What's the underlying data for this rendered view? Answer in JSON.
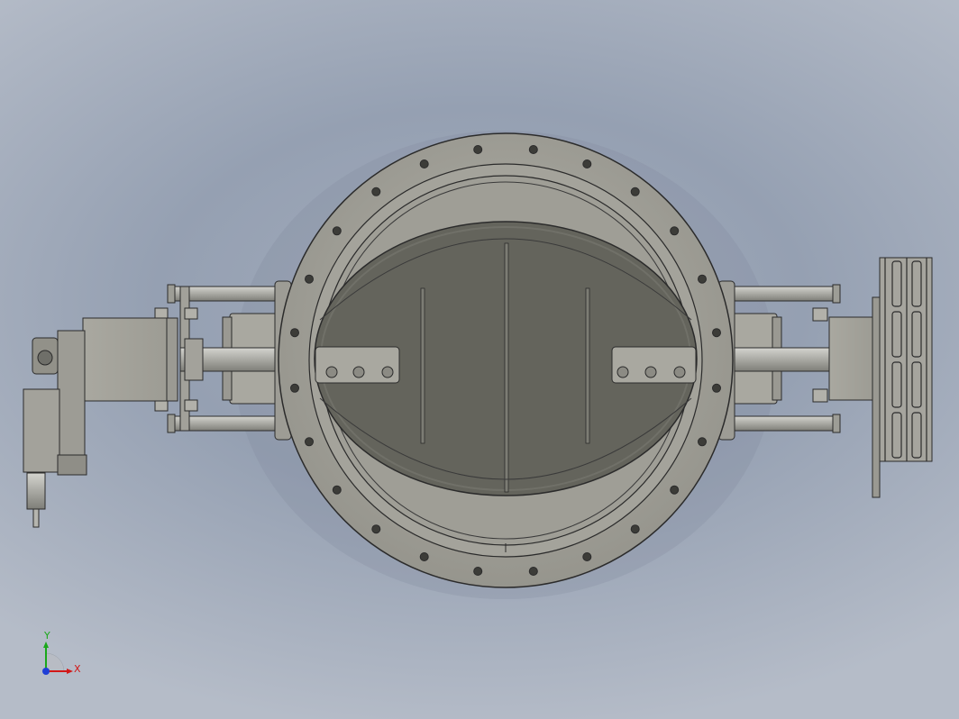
{
  "viewport": {
    "background_colors": [
      "#a3acbc",
      "#95a0b2",
      "#b5bcc8"
    ],
    "model": "butterfly-valve-with-actuator"
  },
  "triad": {
    "y_label": "Y",
    "x_label": "X",
    "y_color": "#1aa81a",
    "x_color": "#d21818",
    "z_color": "#1f3fd6"
  },
  "colors": {
    "body": "#a5a49c",
    "disc": "#64645c",
    "edge": "#2b2b2b",
    "steel": "#bdbdb7"
  }
}
